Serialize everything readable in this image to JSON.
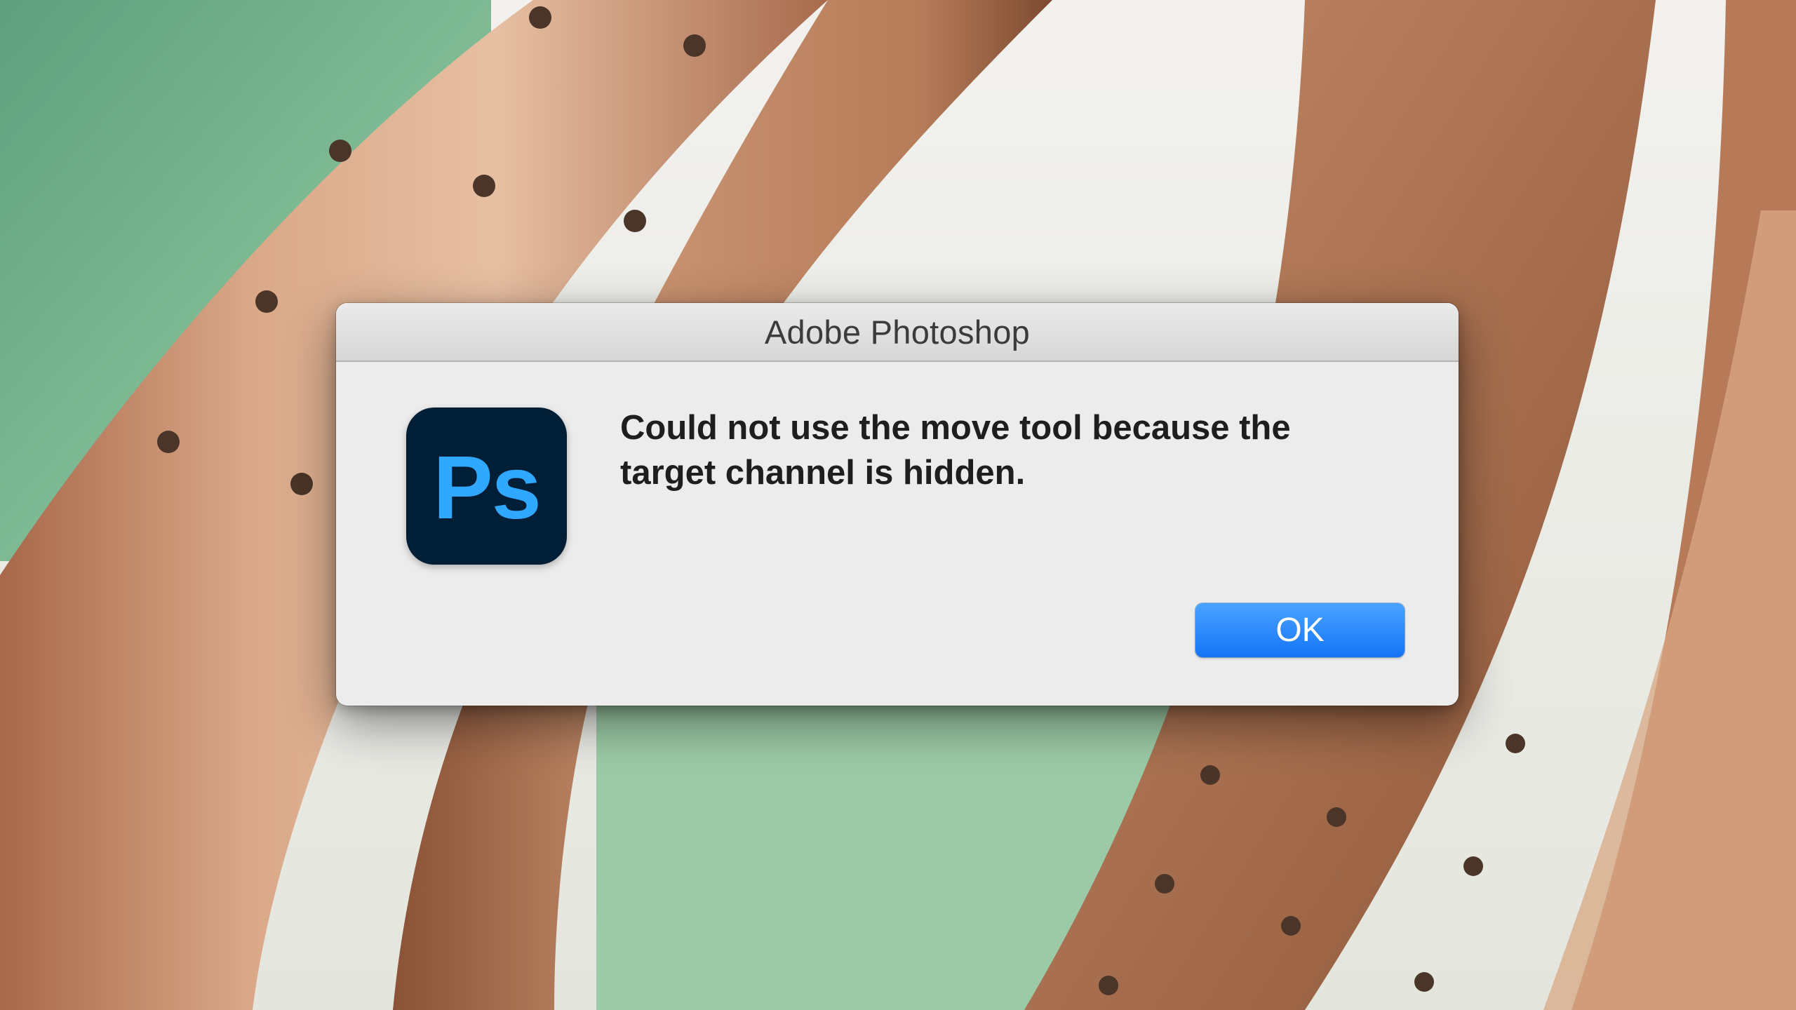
{
  "dialog": {
    "title": "Adobe Photoshop",
    "message": "Could not use the move tool because the target channel is hidden.",
    "ok_label": "OK",
    "app_icon_text": "Ps",
    "app_icon_name": "photoshop-app-icon"
  },
  "colors": {
    "button_accent": "#1474f8",
    "icon_background": "#001e36",
    "icon_text": "#31a8ff"
  }
}
